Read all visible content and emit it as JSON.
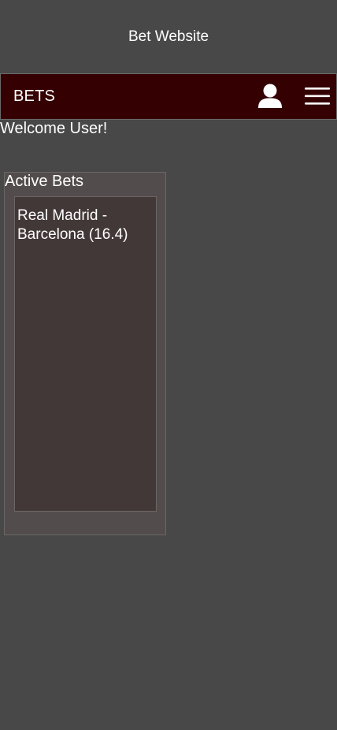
{
  "header": {
    "site_title": "Bet Website"
  },
  "navbar": {
    "brand": "BETS",
    "icons": {
      "user": "user-icon",
      "menu": "hamburger-menu-icon"
    },
    "background": "#340001"
  },
  "welcome": {
    "text": "Welcome User!"
  },
  "active_bets": {
    "title": "Active Bets",
    "items": [
      {
        "label": "Real Madrid - Barcelona (16.4)"
      }
    ]
  },
  "colors": {
    "page_background": "#484848",
    "panel_background": "#524c4c",
    "list_background": "#433838",
    "text": "#ffffff"
  }
}
